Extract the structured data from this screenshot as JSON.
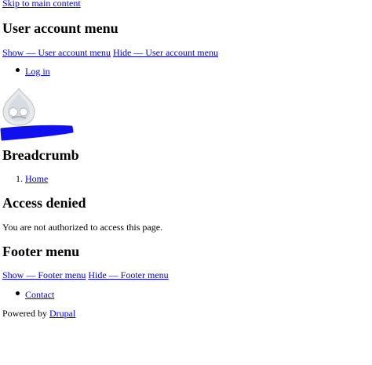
{
  "skip_link": "Skip to main content",
  "user_account_menu": {
    "heading": "User account menu",
    "show_link": "Show — User account menu",
    "hide_link": "Hide — User account menu",
    "items": [
      "Log in"
    ]
  },
  "logo": {
    "icon": "drupal-drop-icon",
    "color": "#cfd2d6"
  },
  "redaction_color": "#1010ee",
  "breadcrumb": {
    "heading": "Breadcrumb",
    "items": [
      {
        "number": "1.",
        "label": "Home"
      }
    ]
  },
  "main": {
    "title": "Access denied",
    "message": "You are not authorized to access this page."
  },
  "footer_menu": {
    "heading": "Footer menu",
    "show_link": "Show — Footer menu",
    "hide_link": "Hide — Footer menu",
    "items": [
      "Contact"
    ]
  },
  "powered_by": {
    "prefix": "Powered by ",
    "link": "Drupal"
  }
}
